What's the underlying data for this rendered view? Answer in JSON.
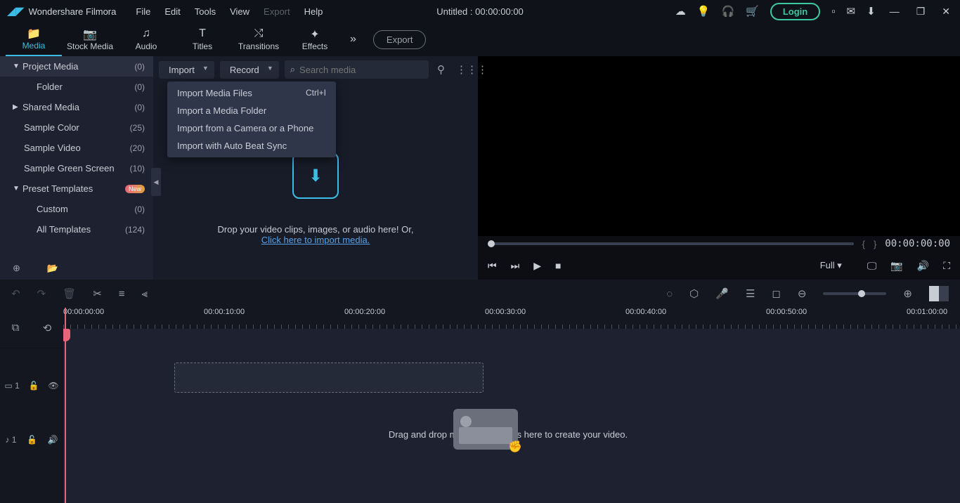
{
  "titlebar": {
    "app_name": "Wondershare Filmora",
    "menus": {
      "file": "File",
      "edit": "Edit",
      "tools": "Tools",
      "view": "View",
      "export": "Export",
      "help": "Help"
    },
    "doc_title": "Untitled : 00:00:00:00",
    "login": "Login"
  },
  "tabs": {
    "media": "Media",
    "stock": "Stock Media",
    "audio": "Audio",
    "titles": "Titles",
    "transitions": "Transitions",
    "effects": "Effects",
    "export_btn": "Export"
  },
  "sidebar": {
    "project_media": {
      "label": "Project Media",
      "count": "(0)"
    },
    "folder": {
      "label": "Folder",
      "count": "(0)"
    },
    "shared_media": {
      "label": "Shared Media",
      "count": "(0)"
    },
    "sample_color": {
      "label": "Sample Color",
      "count": "(25)"
    },
    "sample_video": {
      "label": "Sample Video",
      "count": "(20)"
    },
    "sample_green": {
      "label": "Sample Green Screen",
      "count": "(10)"
    },
    "preset": {
      "label": "Preset Templates",
      "badge": "New"
    },
    "custom": {
      "label": "Custom",
      "count": "(0)"
    },
    "all_templates": {
      "label": "All Templates",
      "count": "(124)"
    }
  },
  "media_toolbar": {
    "import": "Import",
    "record": "Record",
    "search_placeholder": "Search media"
  },
  "import_menu": {
    "files": {
      "label": "Import Media Files",
      "shortcut": "Ctrl+I"
    },
    "folder": {
      "label": "Import a Media Folder"
    },
    "camera": {
      "label": "Import from a Camera or a Phone"
    },
    "beat": {
      "label": "Import with Auto Beat Sync"
    }
  },
  "dropzone": {
    "line1": "Drop your video clips, images, or audio here! Or,",
    "link": "Click here to import media."
  },
  "preview": {
    "timecode": "00:00:00:00",
    "size": "Full"
  },
  "ruler": {
    "t0": "00:00:00:00",
    "t1": "00:00:10:00",
    "t2": "00:00:20:00",
    "t3": "00:00:30:00",
    "t4": "00:00:40:00",
    "t5": "00:00:50:00",
    "t6": "00:01:00:00"
  },
  "timeline": {
    "hint": "Drag and drop media and effects here to create your video.",
    "video_track": "1",
    "audio_track": "1"
  }
}
